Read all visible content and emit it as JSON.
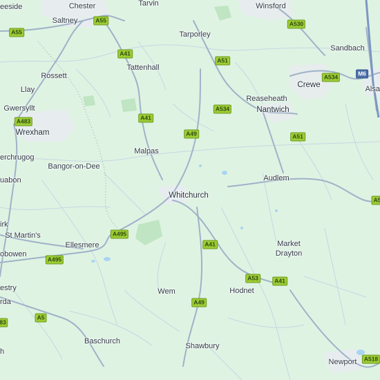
{
  "places": [
    {
      "id": "deeside",
      "name": "eeside"
    },
    {
      "id": "chester",
      "name": "Chester"
    },
    {
      "id": "tarvin",
      "name": "Tarvin"
    },
    {
      "id": "winsford",
      "name": "Winsford"
    },
    {
      "id": "saltney",
      "name": "Saltney"
    },
    {
      "id": "tarporley",
      "name": "Tarporley"
    },
    {
      "id": "sandbach",
      "name": "Sandbach"
    },
    {
      "id": "rossett",
      "name": "Rossett"
    },
    {
      "id": "tattenhall",
      "name": "Tattenhall"
    },
    {
      "id": "crewe",
      "name": "Crewe"
    },
    {
      "id": "alsager",
      "name": "Alsa"
    },
    {
      "id": "llay",
      "name": "Llay"
    },
    {
      "id": "reaseheath",
      "name": "Reaseheath"
    },
    {
      "id": "gwersyllt",
      "name": "Gwersyllt"
    },
    {
      "id": "nantwich",
      "name": "Nantwich"
    },
    {
      "id": "wrexham",
      "name": "Wrexham"
    },
    {
      "id": "marchwiel",
      "name": "erchrugog"
    },
    {
      "id": "malpas",
      "name": "Malpas"
    },
    {
      "id": "bangor",
      "name": "Bangor-on-Dee"
    },
    {
      "id": "ruabon",
      "name": "uabon"
    },
    {
      "id": "audlem",
      "name": "Audlem"
    },
    {
      "id": "whitchurch",
      "name": "Whitchurch"
    },
    {
      "id": "chirk",
      "name": "irk"
    },
    {
      "id": "st-martins",
      "name": "St Martin's"
    },
    {
      "id": "ellesmere",
      "name": "Ellesmere"
    },
    {
      "id": "market-drayton",
      "name": "Market\nDrayton"
    },
    {
      "id": "gobowen",
      "name": "obowen"
    },
    {
      "id": "oswestry",
      "name": "estry"
    },
    {
      "id": "wem",
      "name": "Wem"
    },
    {
      "id": "hodnet",
      "name": "Hodnet"
    },
    {
      "id": "rda",
      "name": "rda"
    },
    {
      "id": "baschurch",
      "name": "Baschurch"
    },
    {
      "id": "shawbury",
      "name": "Shawbury"
    },
    {
      "id": "newport",
      "name": "Newport"
    },
    {
      "id": "h",
      "name": "h"
    }
  ],
  "roads": [
    {
      "id": "a55",
      "label": "A55",
      "type": "primary"
    },
    {
      "id": "a55b",
      "label": "A55",
      "type": "primary"
    },
    {
      "id": "a530",
      "label": "A530",
      "type": "primary"
    },
    {
      "id": "a41a",
      "label": "A41",
      "type": "primary"
    },
    {
      "id": "a51a",
      "label": "A51",
      "type": "primary"
    },
    {
      "id": "m6",
      "label": "M6",
      "type": "motorway"
    },
    {
      "id": "a534a",
      "label": "A534",
      "type": "primary"
    },
    {
      "id": "a534b",
      "label": "A534",
      "type": "primary"
    },
    {
      "id": "a483",
      "label": "A483",
      "type": "primary"
    },
    {
      "id": "a41b",
      "label": "A41",
      "type": "primary"
    },
    {
      "id": "a49a",
      "label": "A49",
      "type": "primary"
    },
    {
      "id": "a51b",
      "label": "A51",
      "type": "primary"
    },
    {
      "id": "a5edge",
      "label": "A5",
      "type": "primary"
    },
    {
      "id": "a495a",
      "label": "A495",
      "type": "primary"
    },
    {
      "id": "a41c",
      "label": "A41",
      "type": "primary"
    },
    {
      "id": "a495b",
      "label": "A495",
      "type": "primary"
    },
    {
      "id": "a53",
      "label": "A53",
      "type": "primary"
    },
    {
      "id": "a41d",
      "label": "A41",
      "type": "primary"
    },
    {
      "id": "a49b",
      "label": "A49",
      "type": "primary"
    },
    {
      "id": "a5",
      "label": "A5",
      "type": "primary"
    },
    {
      "id": "a483edge",
      "label": "83",
      "type": "primary"
    },
    {
      "id": "a518",
      "label": "A518",
      "type": "primary"
    }
  ],
  "colors": {
    "land": "#dff3e3",
    "major_road": "#9fb2c8",
    "minor_road": "#c5d3e0",
    "water": "#a9d4f2",
    "urban": "#e9edf0",
    "woodland": "#c3e6c6",
    "shield": "#9ccc34",
    "motorway": "#4a6ea8"
  }
}
